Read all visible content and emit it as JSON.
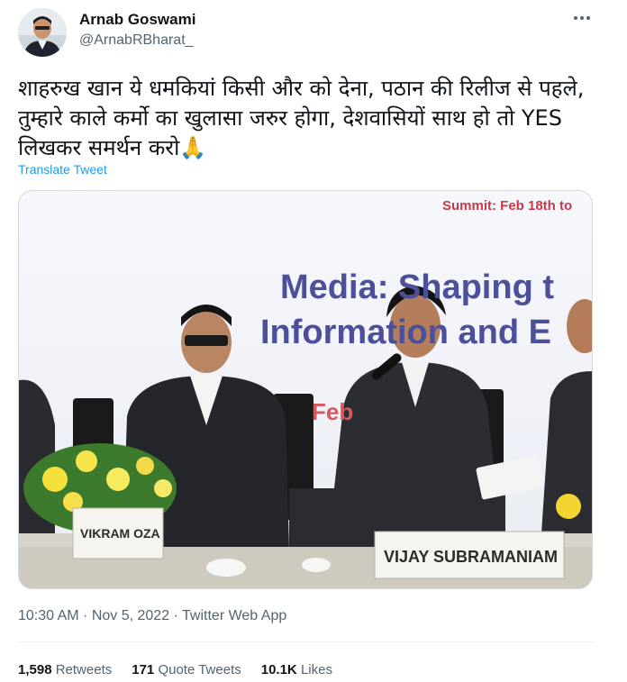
{
  "author": {
    "name": "Arnab Goswami",
    "handle": "@ArnabRBharat_"
  },
  "tweet": {
    "text": "शाहरुख खान ये धमकियां किसी और को देना, पठान की रिलीज से पहले, तुम्हारे काले कर्मो का खुलासा जरुर होगा, देशवासियों साथ हो तो YES लिखकर समर्थन करो🙏",
    "translate_label": "Translate Tweet",
    "timestamp": "10:30 AM · Nov 5, 2022 · Twitter Web App"
  },
  "media": {
    "banner_summit": "Summit: Feb 18th to",
    "banner_line1": "Media: Shaping t",
    "banner_line2": "Information and E",
    "banner_feb": "Feb",
    "nameplate_left": "VIKRAM OZA",
    "nameplate_right": "VIJAY SUBRAMANIAM"
  },
  "stats": {
    "retweets_count": "1,598",
    "retweets_label": "Retweets",
    "quotes_count": "171",
    "quotes_label": "Quote Tweets",
    "likes_count": "10.1K",
    "likes_label": "Likes"
  },
  "colors": {
    "link": "#1d9bf0",
    "secondary_text": "#536471",
    "border": "#cfd9de"
  },
  "icons": [
    "more-options-icon",
    "avatar"
  ]
}
